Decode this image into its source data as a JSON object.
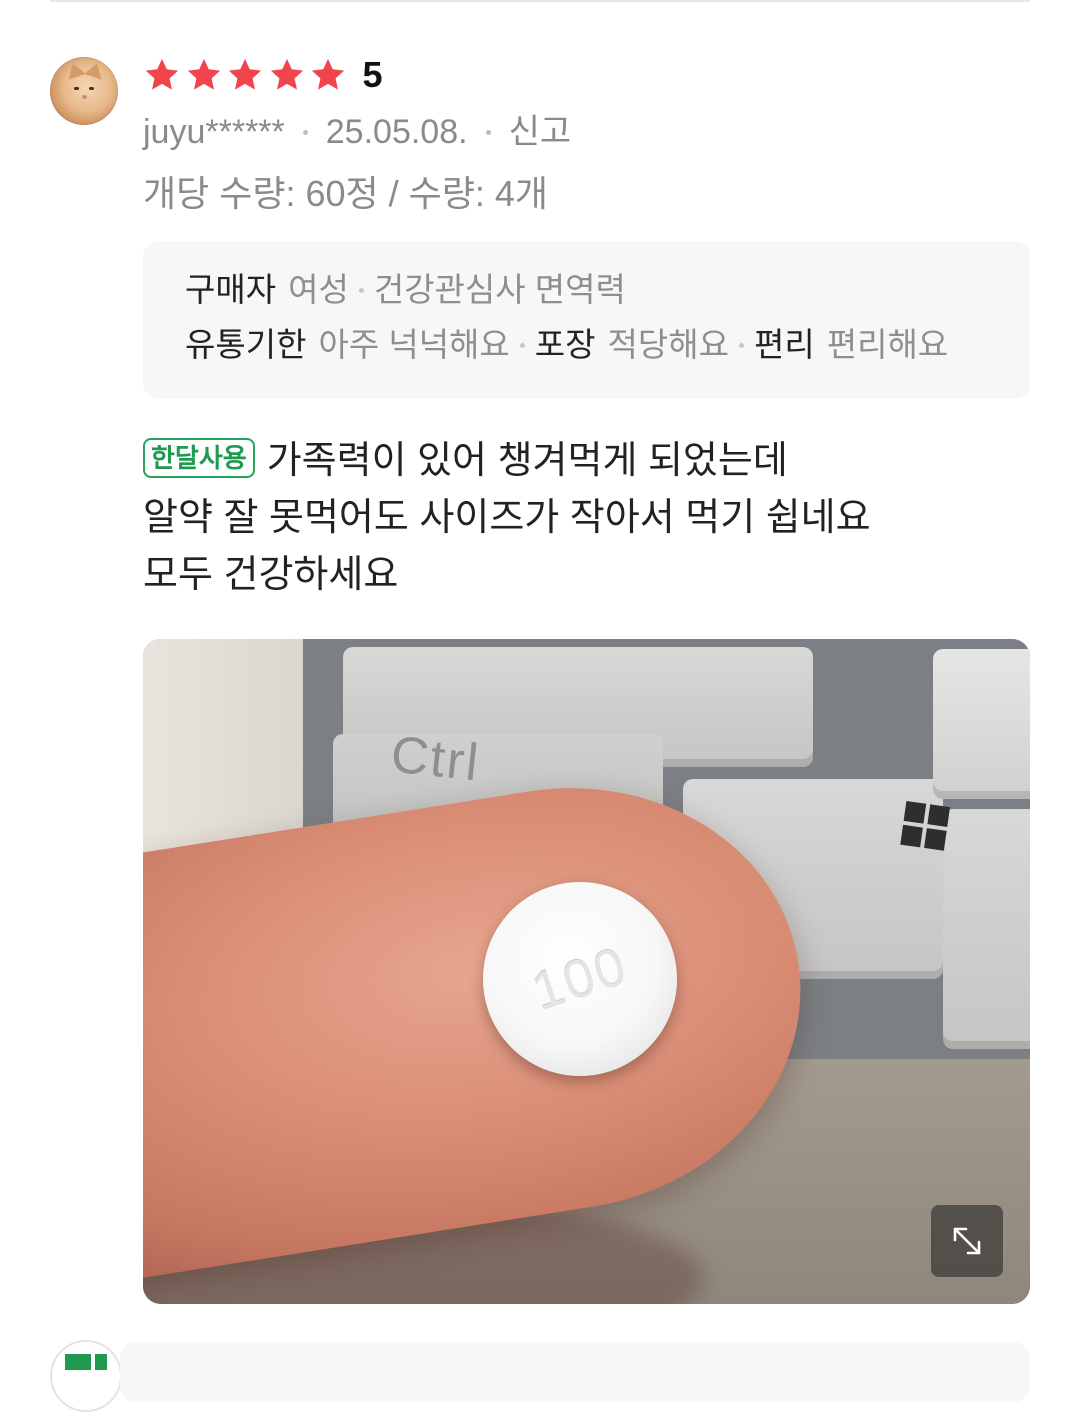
{
  "review": {
    "rating_value": "5",
    "star_count": 5,
    "star_color": "#f0454d",
    "user_id": "juyu******",
    "date": "25.05.08.",
    "report_label": "신고",
    "option_text": "개당 수량: 60정 / 수량: 4개",
    "survey": {
      "buyer_label": "구매자",
      "gender": "여성",
      "interest": "건강관심사 면역력",
      "expiry_label": "유통기한",
      "expiry_value": "아주 넉넉해요",
      "packaging_label": "포장",
      "packaging_value": "적당해요",
      "convenience_label": "편리",
      "convenience_value": "편리해요"
    },
    "badge_label": "한달사용",
    "badge_color": "#27a35a",
    "text_lines": [
      "가족력이 있어 챙겨먹게 되었는데",
      "알약 잘 못먹어도 사이즈가 작아서 먹기 쉽네요",
      "모두 건강하세요"
    ],
    "photo": {
      "key_label": "Ctrl",
      "pill_imprint": "100",
      "expand_icon": "expand-arrows-icon"
    }
  }
}
